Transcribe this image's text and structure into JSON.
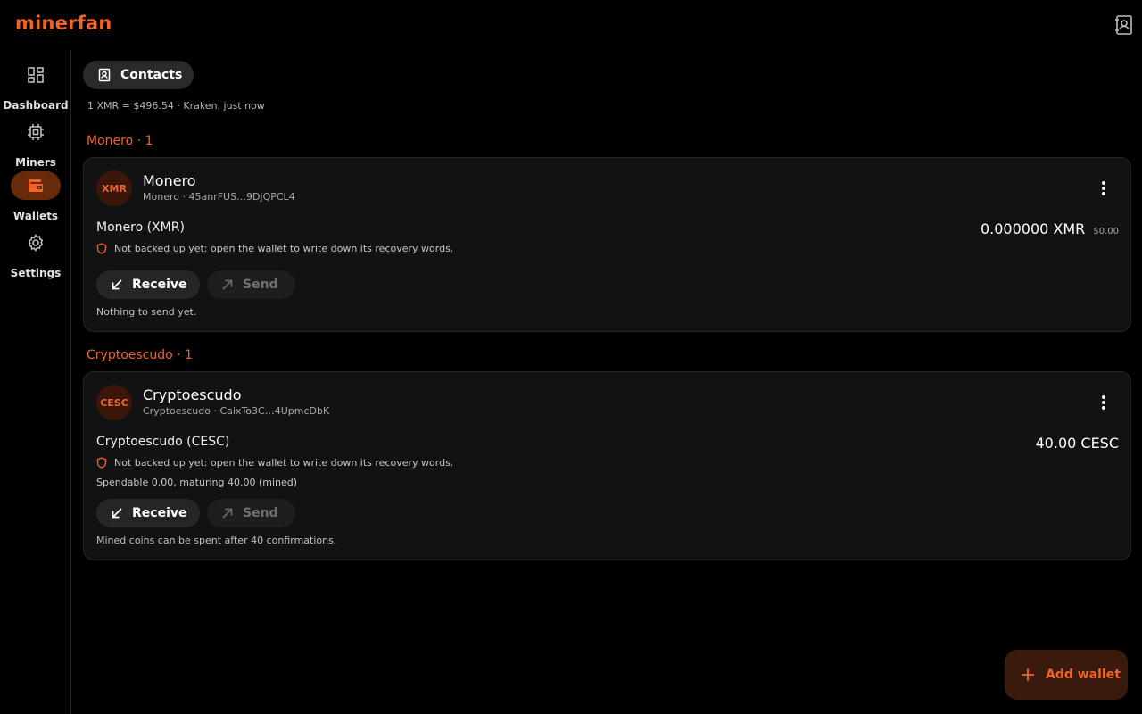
{
  "app": {
    "title": "minerfan"
  },
  "nav": {
    "items": [
      {
        "label": "Dashboard",
        "icon": "dashboard-icon"
      },
      {
        "label": "Miners",
        "icon": "chip-icon"
      },
      {
        "label": "Wallets",
        "icon": "wallet-icon",
        "active": true
      },
      {
        "label": "Settings",
        "icon": "gear-icon"
      }
    ]
  },
  "header": {
    "contacts_label": "Contacts",
    "rate": "1 XMR = $496.54 · Kraken, just now"
  },
  "groups": [
    {
      "heading": "Monero · 1",
      "wallet": {
        "avatar": "XMR",
        "name": "Monero",
        "subtitle": "Monero · 45anrFUS…9DjQPCL4",
        "asset": "Monero (XMR)",
        "balance": "0.000000 XMR",
        "fiat": "$0.00",
        "warning": "Not backed up yet: open the wallet to write down its recovery words.",
        "receive_label": "Receive",
        "send_label": "Send",
        "hint": "Nothing to send yet."
      }
    },
    {
      "heading": "Cryptoescudo · 1",
      "wallet": {
        "avatar": "CESC",
        "name": "Cryptoescudo",
        "subtitle": "Cryptoescudo · CaixTo3C…4UpmcDbK",
        "asset": "Cryptoescudo (CESC)",
        "balance": "40.00 CESC",
        "warning": "Not backed up yet: open the wallet to write down its recovery words.",
        "spendable": "Spendable 0.00, maturing 40.00 (mined)",
        "receive_label": "Receive",
        "send_label": "Send",
        "hint": "Mined coins can be spent after 40 confirmations."
      }
    }
  ],
  "fab": {
    "label": "Add wallet"
  },
  "colors": {
    "accent": "#f0642a",
    "background": "#000000",
    "card": "#121212"
  }
}
